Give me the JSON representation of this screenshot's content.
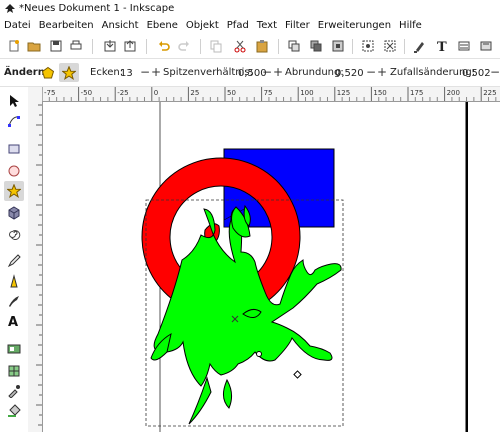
{
  "window": {
    "title": "*Neues Dokument 1 - Inkscape"
  },
  "menu": [
    "Datei",
    "Bearbeiten",
    "Ansicht",
    "Ebene",
    "Objekt",
    "Pfad",
    "Text",
    "Filter",
    "Erweiterungen",
    "Hilfe"
  ],
  "controls": {
    "change_label": "Ändern:",
    "corners_label": "Ecken:",
    "corners_value": "13",
    "spoke_label": "Spitzenverhältnis:",
    "spoke_value": "0,500",
    "rounding_label": "Abrundung:",
    "rounding_value": "0,520",
    "random_label": "Zufallsänderung:",
    "random_value": "0,502",
    "minus": "−",
    "plus": "+"
  },
  "ruler": {
    "labels": [
      "-75",
      "-50",
      "-25",
      "0",
      "25",
      "50",
      "75",
      "100",
      "125",
      "150",
      "175",
      "200",
      "225"
    ]
  },
  "colors": {
    "red": "#ff0000",
    "blue": "#0000ff",
    "green": "#00ff00",
    "toolbar_bg": "#ffffff",
    "active_tool": "#d8d8d8"
  },
  "tools": [
    "selector-tool",
    "node-tool",
    "rectangle-tool",
    "circle-tool",
    "star-tool",
    "3dbox-tool",
    "spiral-tool",
    "pencil-tool",
    "pen-tool",
    "calligraphy-tool",
    "text-tool",
    "gradient-tool",
    "connector-tool",
    "dropper-tool",
    "paint-bucket-tool"
  ]
}
